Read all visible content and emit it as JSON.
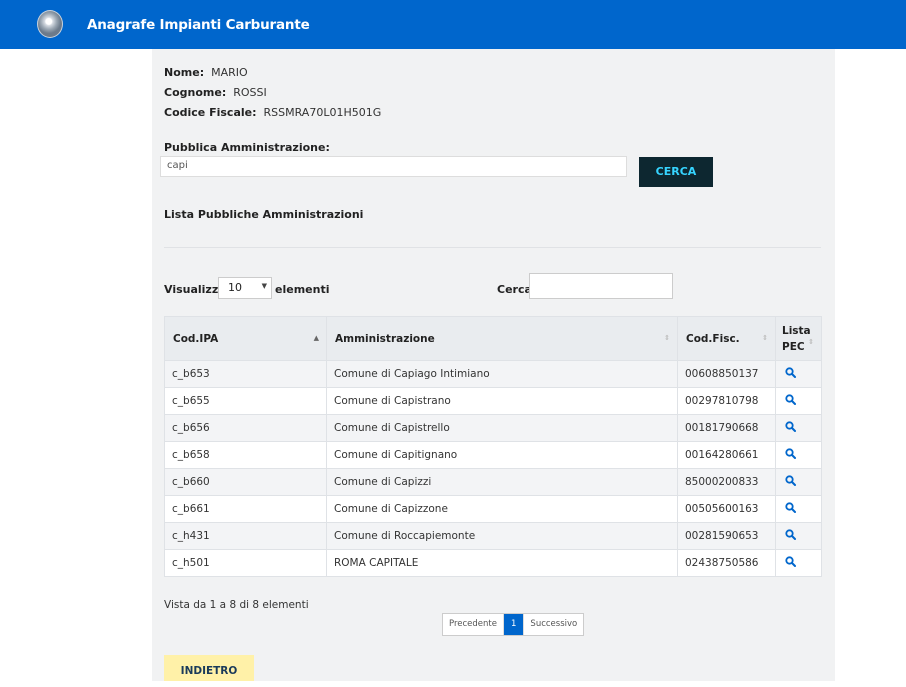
{
  "header": {
    "app_title": "Anagrafe Impianti Carburante",
    "logo_icon": "republic-emblem-icon"
  },
  "user": {
    "nome_label": "Nome",
    "nome_value": "MARIO",
    "cognome_label": "Cognome",
    "cognome_value": "ROSSI",
    "cf_label": "Codice Fiscale",
    "cf_value": "RSSMRA70L01H501G"
  },
  "search": {
    "label": "Pubblica Amministrazione",
    "value": "capi",
    "button": "CERCA"
  },
  "list_title": "Lista Pubbliche Amministrazioni",
  "table_controls": {
    "show_label": "Visualizza",
    "page_size": "10",
    "items_label": "elementi",
    "filter_label": "Cerca:"
  },
  "table": {
    "columns": [
      "Cod.IPA",
      "Amministrazione",
      "Cod.Fisc.",
      "Lista PEC"
    ],
    "sorted_column": "Cod.IPA",
    "rows": [
      {
        "ipa": "c_b653",
        "amm": "Comune di Capiago Intimiano",
        "cf": "00608850137"
      },
      {
        "ipa": "c_b655",
        "amm": "Comune di Capistrano",
        "cf": "00297810798"
      },
      {
        "ipa": "c_b656",
        "amm": "Comune di Capistrello",
        "cf": "00181790668"
      },
      {
        "ipa": "c_b658",
        "amm": "Comune di Capitignano",
        "cf": "00164280661"
      },
      {
        "ipa": "c_b660",
        "amm": "Comune di Capizzi",
        "cf": "85000200833"
      },
      {
        "ipa": "c_b661",
        "amm": "Comune di Capizzone",
        "cf": "00505600163"
      },
      {
        "ipa": "c_h431",
        "amm": "Comune di Roccapiemonte",
        "cf": "00281590653"
      },
      {
        "ipa": "c_h501",
        "amm": "ROMA CAPITALE",
        "cf": "02438750586"
      }
    ],
    "row_action_icon": "search-icon"
  },
  "footer": {
    "summary": "Vista da 1 a 8 di 8 elementi",
    "prev": "Precedente",
    "page": "1",
    "next": "Successivo",
    "back_button": "INDIETRO"
  },
  "colors": {
    "header_bg": "#0066cc",
    "cerca_bg": "#0d2730",
    "cerca_text": "#36d4ff",
    "indietro_bg": "#fff1a8"
  }
}
